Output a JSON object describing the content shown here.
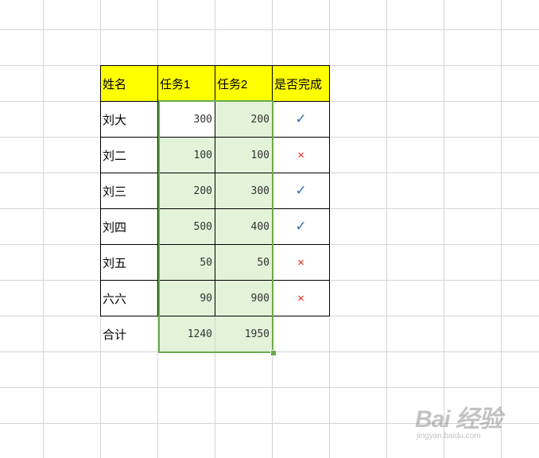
{
  "table": {
    "headers": [
      "姓名",
      "任务1",
      "任务2",
      "是否完成"
    ],
    "rows": [
      {
        "name": "刘大",
        "task1": "300",
        "task2": "200",
        "done": "✓",
        "done_icon": "check-icon"
      },
      {
        "name": "刘二",
        "task1": "100",
        "task2": "100",
        "done": "×",
        "done_icon": "cross-icon"
      },
      {
        "name": "刘三",
        "task1": "200",
        "task2": "300",
        "done": "✓",
        "done_icon": "check-icon"
      },
      {
        "name": "刘四",
        "task1": "500",
        "task2": "400",
        "done": "✓",
        "done_icon": "check-icon"
      },
      {
        "name": "刘五",
        "task1": "50",
        "task2": "50",
        "done": "×",
        "done_icon": "cross-icon"
      },
      {
        "name": "六六",
        "task1": "90",
        "task2": "900",
        "done": "×",
        "done_icon": "cross-icon"
      }
    ],
    "total": {
      "label": "合计",
      "task1": "1240",
      "task2": "1950"
    }
  },
  "colors": {
    "header_fill": "#ffff00",
    "selection_fill": "#e2f3d9",
    "selection_border": "#6aaa4c",
    "check_color": "#2e6fb5",
    "cross_color": "#e0201b"
  },
  "watermark": {
    "main": "Bai 经验",
    "sub": "jingyan.baidu.com"
  }
}
